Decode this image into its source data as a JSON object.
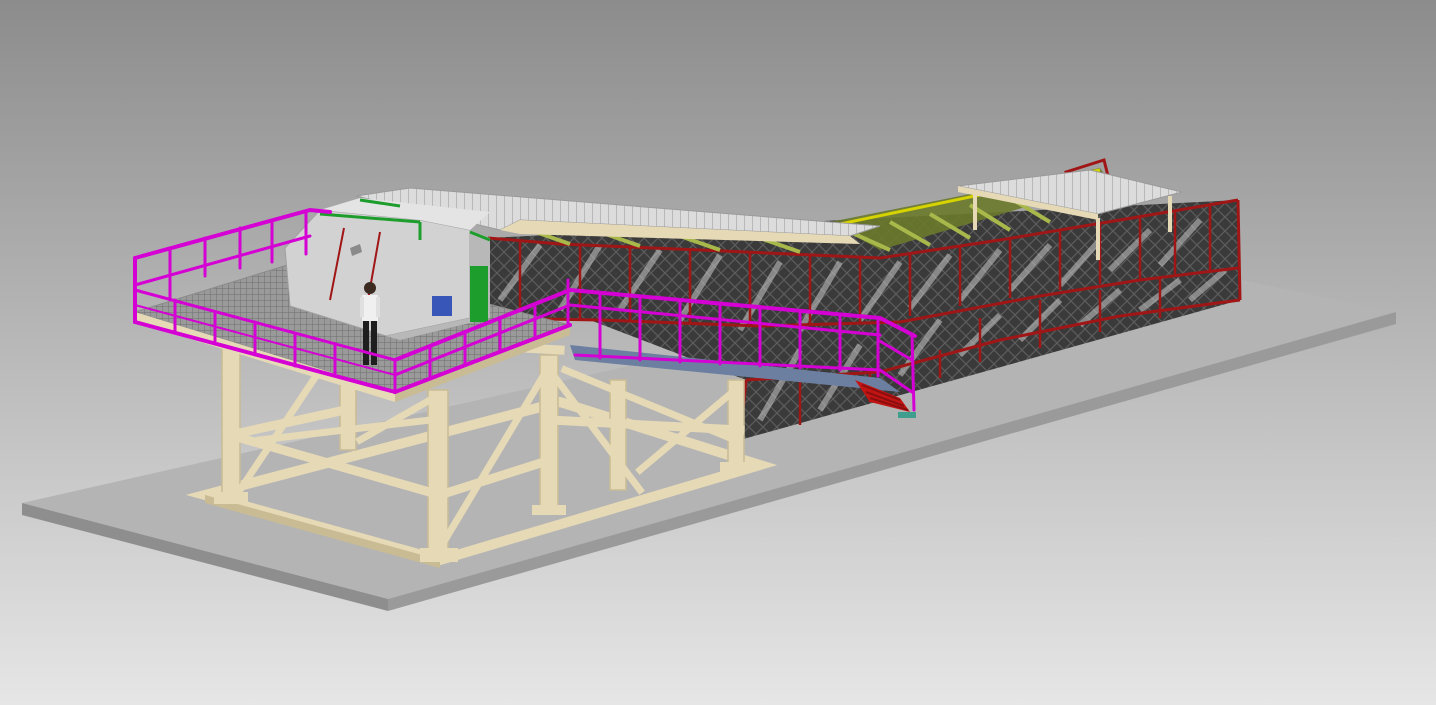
{
  "viewport": {
    "background_top": "#8c8c8c",
    "background_bottom": "#e6e6e6"
  },
  "colors": {
    "ground": "#b4b4b4",
    "ground_edge": "#8e8e8e",
    "structure": "#e6d9b6",
    "structure_shade": "#c9bb93",
    "handrail": "#d400d4",
    "panel_frame": "#a01616",
    "panel_mesh": "#3a3a3a",
    "truss": "#8a9a3c",
    "housing": "#d2d2d2",
    "housing_accent": "#1d9d2b",
    "roof": "#dcdcdc",
    "walkway": "#6c7fa0",
    "stair": "#c31414",
    "stair_base": "#3f9e8e",
    "figure_shirt": "#f0f0f0",
    "figure_pants": "#1e1e1e"
  },
  "scene": {
    "objects": [
      "ground-slab",
      "support-tower",
      "grated-platform",
      "platform-handrail",
      "drive-housing",
      "human-figure",
      "inclined-conveyor-gallery",
      "mesh-guard-panels",
      "conveyor-roof",
      "tail-canopy",
      "side-walkway",
      "access-stair"
    ]
  }
}
